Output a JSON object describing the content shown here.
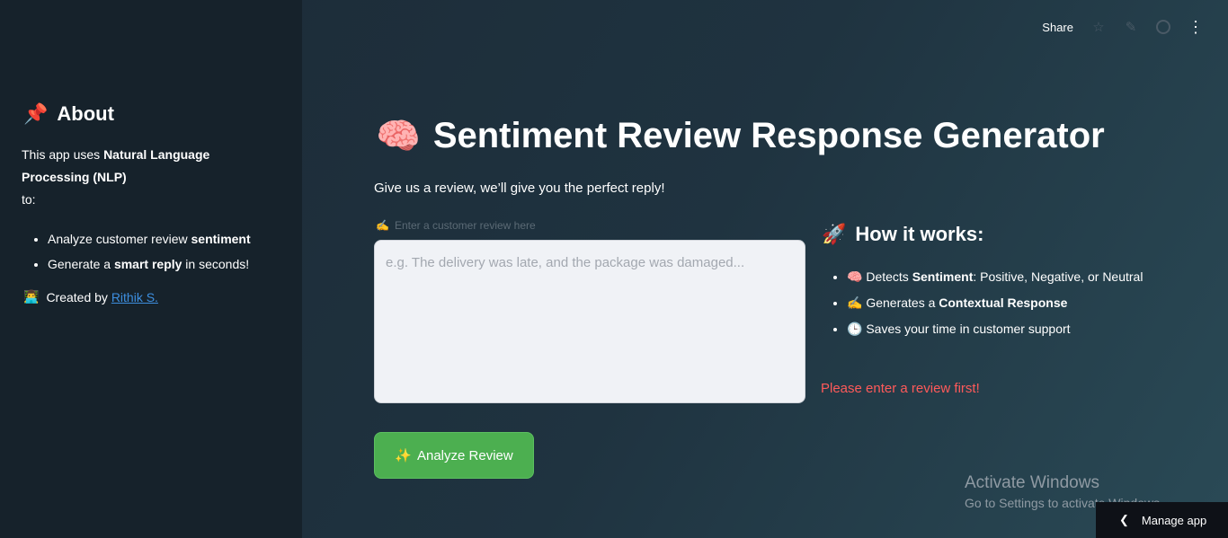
{
  "sidebar": {
    "about_icon": "📌",
    "about_title": "About",
    "text_plain1": "This app uses ",
    "text_bold1": "Natural Language Processing (NLP)",
    "text_plain2": "to:",
    "items": [
      {
        "plain": "Analyze customer review ",
        "bold": "sentiment",
        "after": ""
      },
      {
        "plain": "Generate a ",
        "bold": "smart reply",
        "after": " in seconds!"
      }
    ],
    "created_icon": "👨‍💻",
    "created_text": "Created by ",
    "author_link": "Rithik S."
  },
  "topbar": {
    "share": "Share",
    "icons": [
      "star-icon",
      "edit-icon",
      "github-icon",
      "menu-icon"
    ]
  },
  "main": {
    "title_icon": "🧠",
    "title": "Sentiment Review Response Generator",
    "subtitle": "Give us a review, we’ll give you the perfect reply!",
    "input_label_icon": "✍️",
    "input_label": "Enter a customer review here",
    "input_placeholder": "e.g. The delivery was late, and the package was damaged...",
    "button_icon": "✨",
    "button_label": "Analyze Review"
  },
  "how": {
    "icon": "🚀",
    "title": "How it works:",
    "items": [
      {
        "icon": "🧠",
        "plain": "Detects ",
        "bold": "Sentiment",
        "after": ": Positive, Negative, or Neutral"
      },
      {
        "icon": "✍️",
        "plain": "Generates a ",
        "bold": "Contextual Response",
        "after": ""
      },
      {
        "icon": "🕒",
        "plain": "Saves your time in customer support",
        "bold": "",
        "after": ""
      }
    ],
    "warning": "Please enter a review first!"
  },
  "watermark": {
    "line1": "Activate Windows",
    "line2": "Go to Settings to activate Windows."
  },
  "manage_app": "Manage app",
  "colors": {
    "accent_green": "#4caf50",
    "warning_red": "#ff5a5a",
    "link_blue": "#3d8fe0"
  }
}
